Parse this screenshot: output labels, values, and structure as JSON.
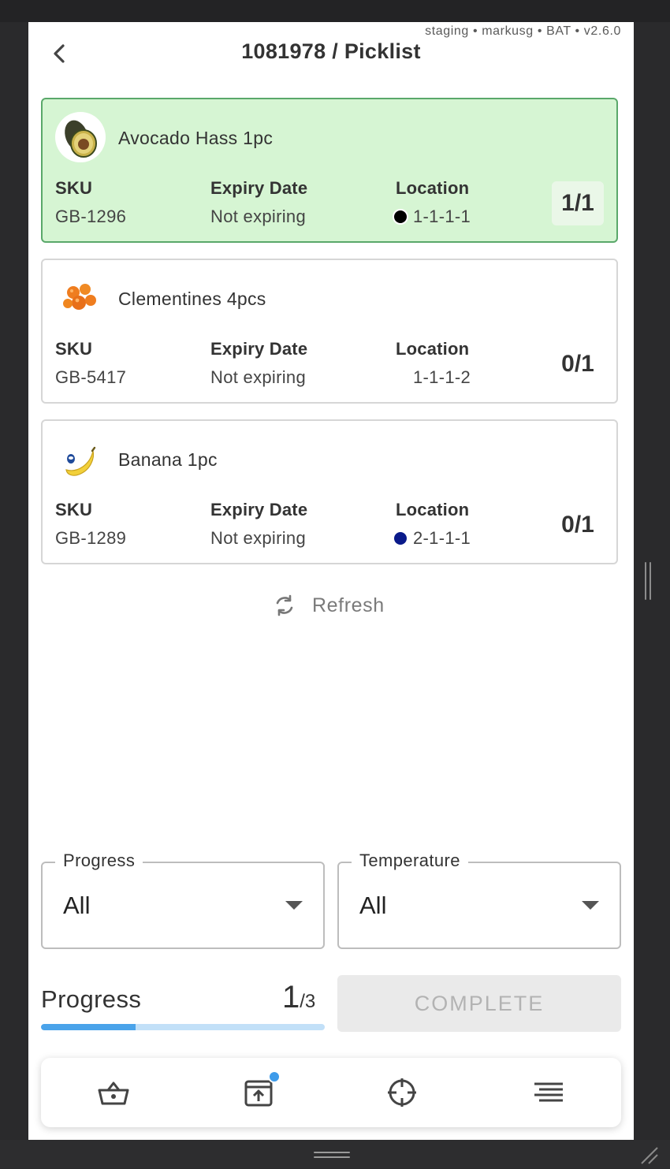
{
  "env_label": "staging • markusg • BAT • v2.6.0",
  "header": {
    "title": "1081978 / Picklist"
  },
  "columns": {
    "sku": "SKU",
    "expiry": "Expiry Date",
    "location": "Location"
  },
  "items": [
    {
      "name": "Avocado Hass 1pc",
      "sku": "GB-1296",
      "expiry": "Not expiring",
      "location": "1-1-1-1",
      "location_dot": "#000000",
      "count": "1/1",
      "picked": true,
      "image": "avocado"
    },
    {
      "name": "Clementines 4pcs",
      "sku": "GB-5417",
      "expiry": "Not expiring",
      "location": "1-1-1-2",
      "location_dot": "",
      "count": "0/1",
      "picked": false,
      "image": "clementines"
    },
    {
      "name": "Banana 1pc",
      "sku": "GB-1289",
      "expiry": "Not expiring",
      "location": "2-1-1-1",
      "location_dot": "#0a1a8a",
      "count": "0/1",
      "picked": false,
      "image": "banana"
    }
  ],
  "refresh": {
    "label": "Refresh",
    "icon": "refresh-icon"
  },
  "filters": {
    "progress": {
      "label": "Progress",
      "value": "All"
    },
    "temperature": {
      "label": "Temperature",
      "value": "All"
    }
  },
  "progress": {
    "label": "Progress",
    "done": "1",
    "total": "/3",
    "fraction": 0.3333
  },
  "complete_button": "COMPLETE",
  "nav": [
    {
      "icon": "basket-icon"
    },
    {
      "icon": "upload-box-icon",
      "badge": true
    },
    {
      "icon": "crosshair-icon"
    },
    {
      "icon": "menu-lines-icon"
    }
  ],
  "colors": {
    "done_bg": "#d6f5d3",
    "done_border": "#5aa86a",
    "accent": "#4aa3ea",
    "track": "#c2e0f8"
  }
}
